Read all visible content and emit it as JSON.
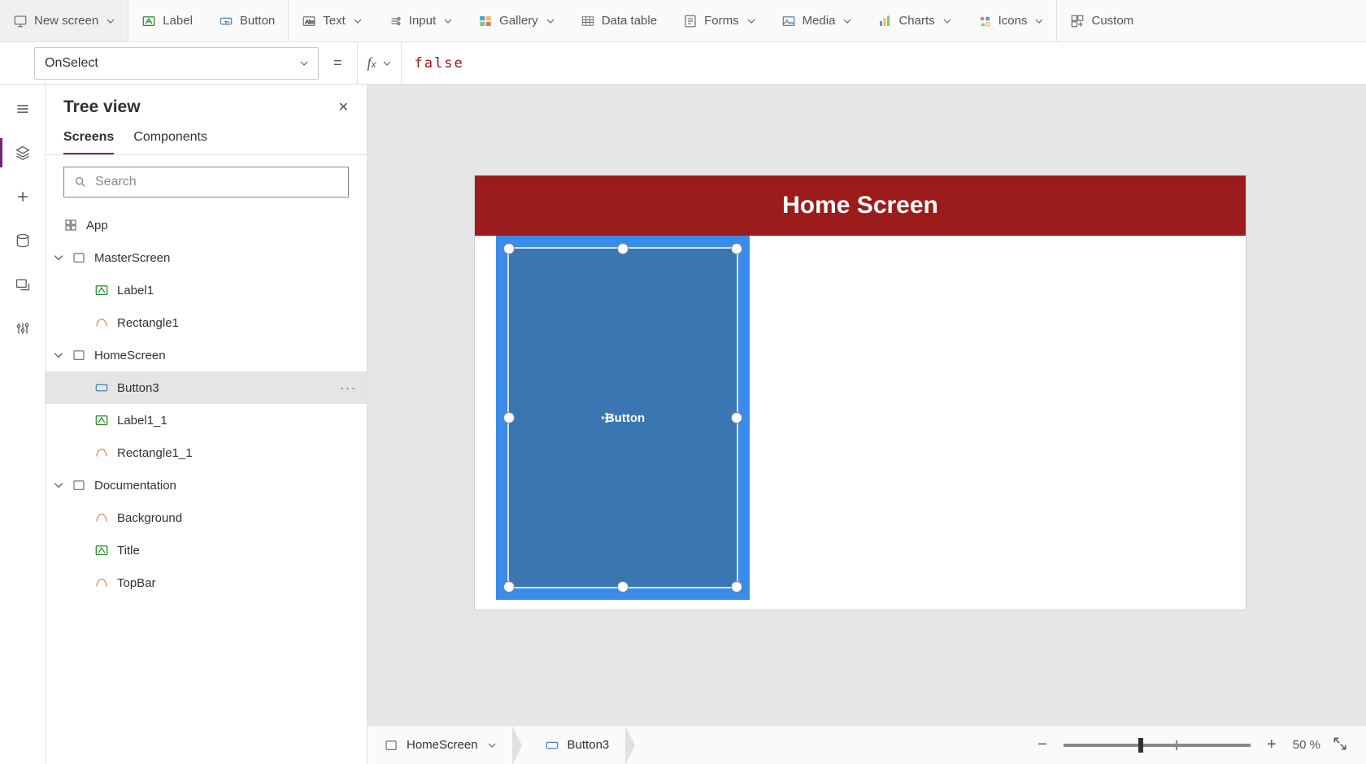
{
  "ribbon": {
    "newScreen": "New screen",
    "label": "Label",
    "button": "Button",
    "text": "Text",
    "input": "Input",
    "gallery": "Gallery",
    "dataTable": "Data table",
    "forms": "Forms",
    "media": "Media",
    "charts": "Charts",
    "icons": "Icons",
    "custom": "Custom"
  },
  "formula": {
    "property": "OnSelect",
    "equals": "=",
    "value": "false"
  },
  "treeView": {
    "title": "Tree view",
    "tabScreens": "Screens",
    "tabComponents": "Components",
    "searchPlaceholder": "Search",
    "nodes": {
      "app": "App",
      "master": "MasterScreen",
      "label1": "Label1",
      "rect1": "Rectangle1",
      "home": "HomeScreen",
      "button3": "Button3",
      "label11": "Label1_1",
      "rect11": "Rectangle1_1",
      "doc": "Documentation",
      "background": "Background",
      "title": "Title",
      "topbar": "TopBar"
    }
  },
  "canvas": {
    "screenTitle": "Home Screen",
    "buttonText": "Button"
  },
  "status": {
    "crumbScreen": "HomeScreen",
    "crumbControl": "Button3",
    "zoom": "50",
    "zoomSuffix": "%"
  }
}
